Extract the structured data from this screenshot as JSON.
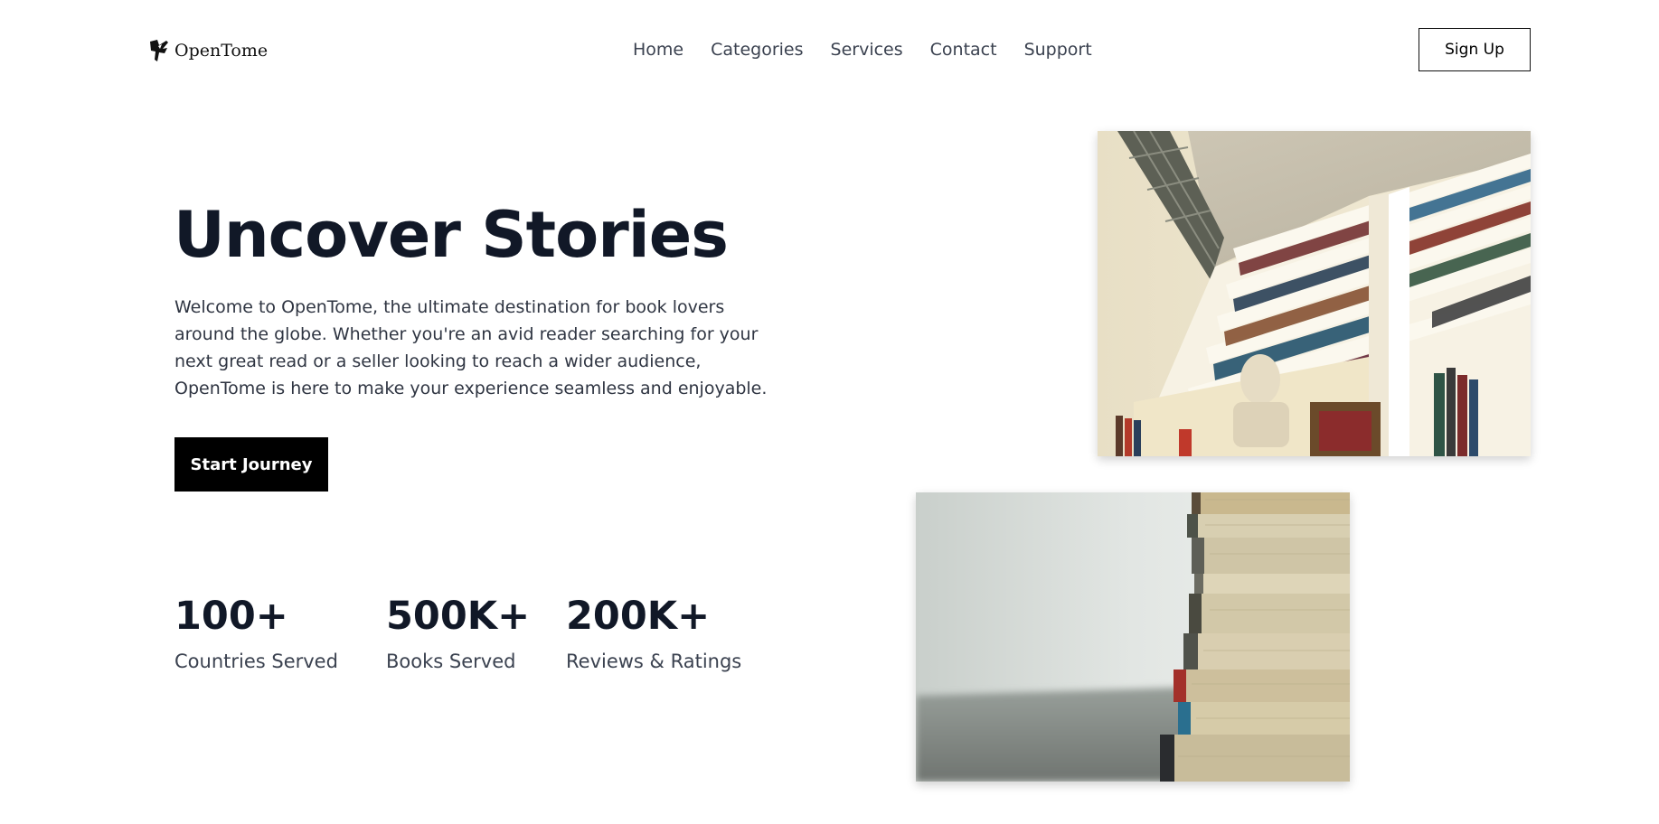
{
  "brand": {
    "name": "OpenTome",
    "logo_icon": "book-wing-logo-icon"
  },
  "nav": {
    "items": [
      "Home",
      "Categories",
      "Services",
      "Contact",
      "Support"
    ]
  },
  "header": {
    "signup_label": "Sign Up"
  },
  "hero": {
    "title": "Uncover Stories",
    "description": "Welcome to OpenTome, the ultimate destination for book lovers around the globe. Whether you're an avid reader searching for your next great read or a seller looking to reach a wider audience, OpenTome is here to make your experience seamless and enjoyable.",
    "cta_label": "Start Journey"
  },
  "stats": [
    {
      "value": "100+",
      "label": "Countries Served"
    },
    {
      "value": "500K+",
      "label": "Books Served"
    },
    {
      "value": "200K+",
      "label": "Reviews & Ratings"
    }
  ],
  "images": {
    "top": "bookshelf-photo",
    "bottom": "book-stack-photo"
  },
  "colors": {
    "primary_text": "#111827",
    "body_text": "#2f3542",
    "button_bg": "#000000",
    "button_text": "#ffffff",
    "background": "#ffffff"
  }
}
